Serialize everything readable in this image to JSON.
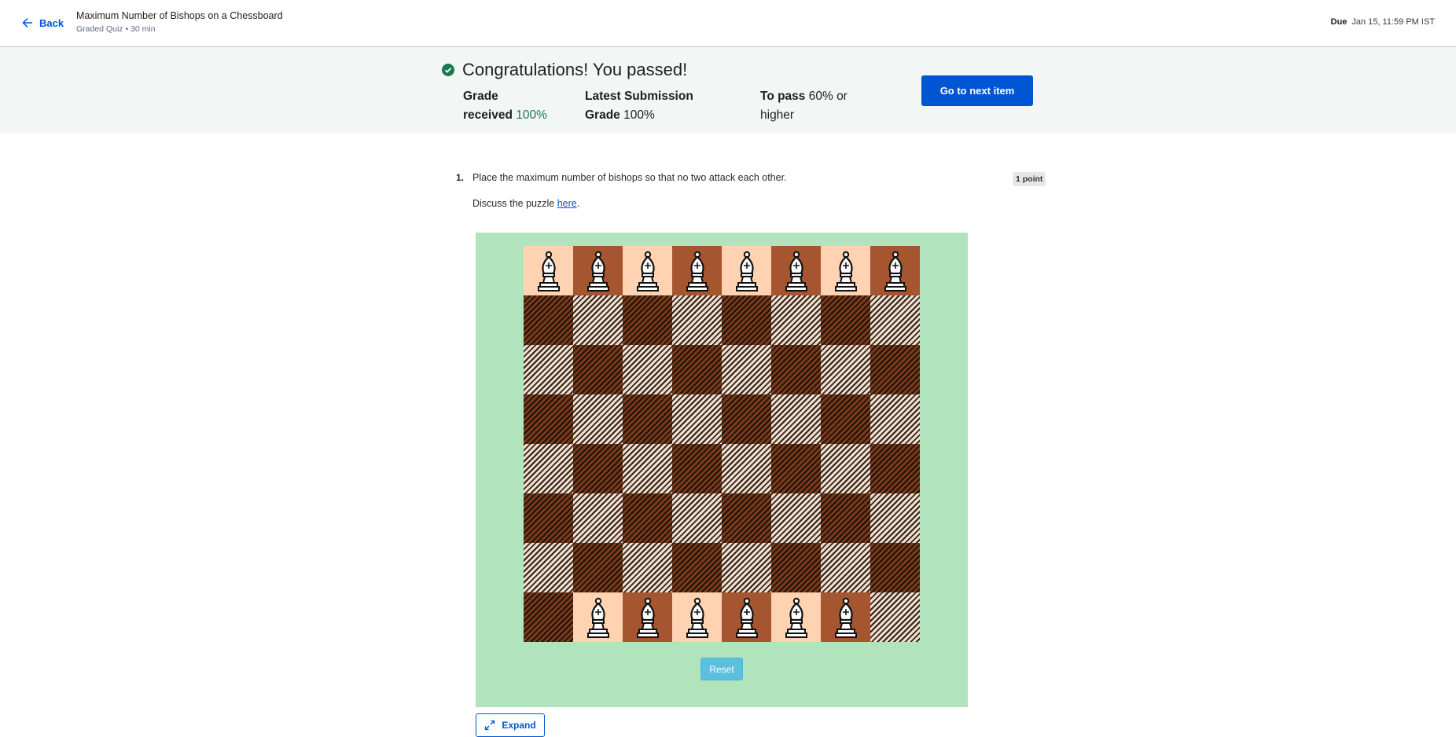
{
  "header": {
    "back_label": "Back",
    "title": "Maximum Number of Bishops on a Chessboard",
    "subtitle": "Graded Quiz • 30 min",
    "due_label": "Due",
    "due_value": "Jan 15, 11:59 PM IST"
  },
  "banner": {
    "message": "Congratulations! You passed!",
    "grade_received_label_1": "Grade",
    "grade_received_label_2": "received",
    "grade_received_value": "100%",
    "latest_label_1": "Latest Submission",
    "latest_label_2": "Grade",
    "latest_value": "100%",
    "to_pass_label": "To pass",
    "to_pass_value_1": "60% or",
    "to_pass_value_2": "higher",
    "next_button": "Go to next item",
    "accent_color": "#0056d2",
    "success_color": "#1c7a52"
  },
  "question": {
    "number": "1.",
    "text": "Place the maximum number of bishops so that no two  attack each other.",
    "points": "1 point",
    "discuss_prefix": "Discuss the puzzle ",
    "discuss_link": "here",
    "discuss_suffix": "."
  },
  "puzzle": {
    "board_size": 8,
    "bishop_rows": {
      "top": [
        true,
        true,
        true,
        true,
        true,
        true,
        true,
        true
      ],
      "bottom": [
        false,
        true,
        true,
        true,
        true,
        true,
        true,
        false
      ]
    },
    "reset_label": "Reset",
    "expand_label": "Expand",
    "background_color": "#b1e3bc"
  }
}
